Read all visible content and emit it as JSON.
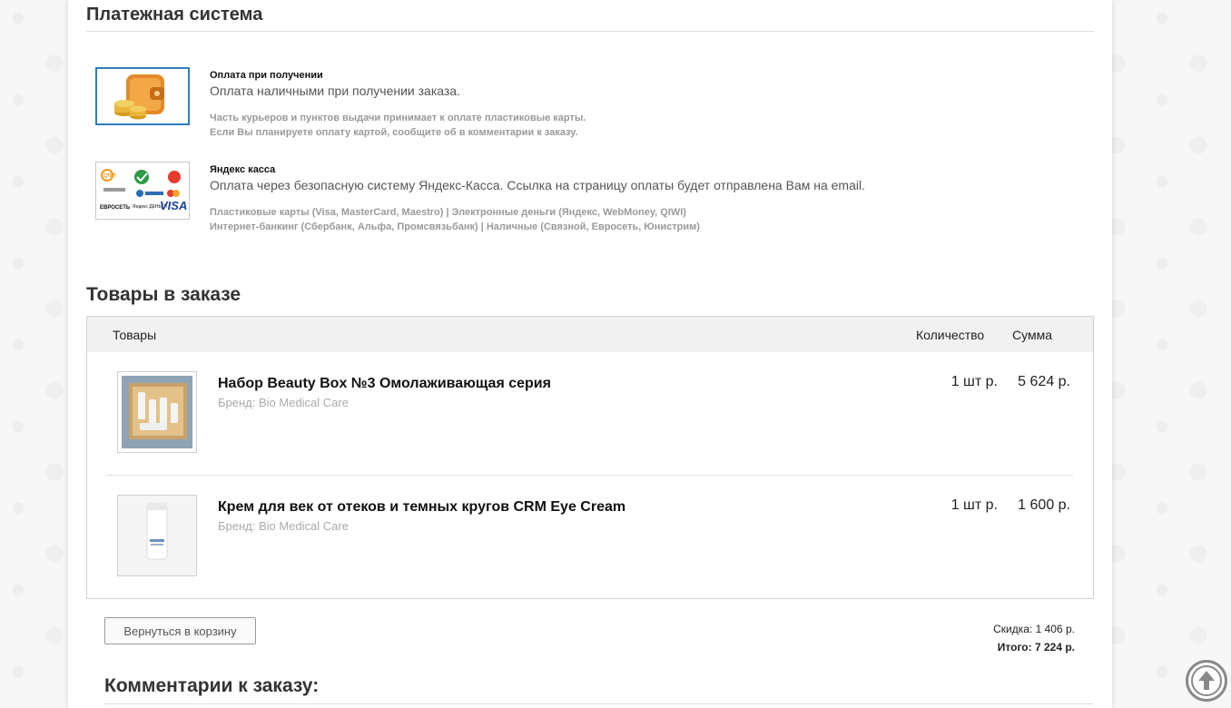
{
  "payment": {
    "heading": "Платежная система",
    "methods": [
      {
        "title": "Оплата при получении",
        "description": "Оплата наличными при получении заказа.",
        "notes": [
          "Часть курьеров и пунктов выдачи принимает к оплате пластиковые карты.",
          "Если Вы планируете оплату картой, сообщите об в комментарии к заказу."
        ],
        "icon": "wallet-icon"
      },
      {
        "title": "Яндекс касса",
        "description": "Оплата через безопасную систему Яндекс-Касса. Ссылка на страницу оплаты будет отправлена Вам на email.",
        "notes": [
          "Пластиковые карты (Visa, MasterCard, Maestro) | Электронные деньги (Яндекс, WebMoney, QIWI)",
          "Интернет-банкинг (Сбербанк, Альфа, Промсвязьбанк) | Наличные (Связной, Евросеть, Юнистрим)"
        ],
        "logos": {
          "qiwi": "QIWI",
          "evroset": "ЕВРОСЕТЬ",
          "yandex_money": "Яндекс ДЕНЬГИ",
          "visa": "VISA"
        },
        "icon": "payment-systems-icon"
      }
    ]
  },
  "order": {
    "heading": "Товары в заказе",
    "columns": {
      "goods": "Товары",
      "qty": "Количество",
      "sum": "Сумма"
    },
    "items": [
      {
        "name": "Набор Beauty Box №3 Омолаживающая серия",
        "brand": "Бренд: Bio Medical Care",
        "qty": "1 шт р.",
        "sum": "5 624 р."
      },
      {
        "name": "Крем для век от отеков и темных кругов CRM Eye Cream",
        "brand": "Бренд: Bio Medical Care",
        "qty": "1 шт р.",
        "sum": "1 600 р."
      }
    ]
  },
  "actions": {
    "back_label": "Вернуться в корзину"
  },
  "totals": {
    "discount": "Скидка: 1 406 р.",
    "total": "Итого: 7 224 р."
  },
  "comments": {
    "heading": "Комментарии к заказу:"
  },
  "colors": {
    "accent_border": "#2f7fbd",
    "text_muted": "#9a9a9a"
  }
}
